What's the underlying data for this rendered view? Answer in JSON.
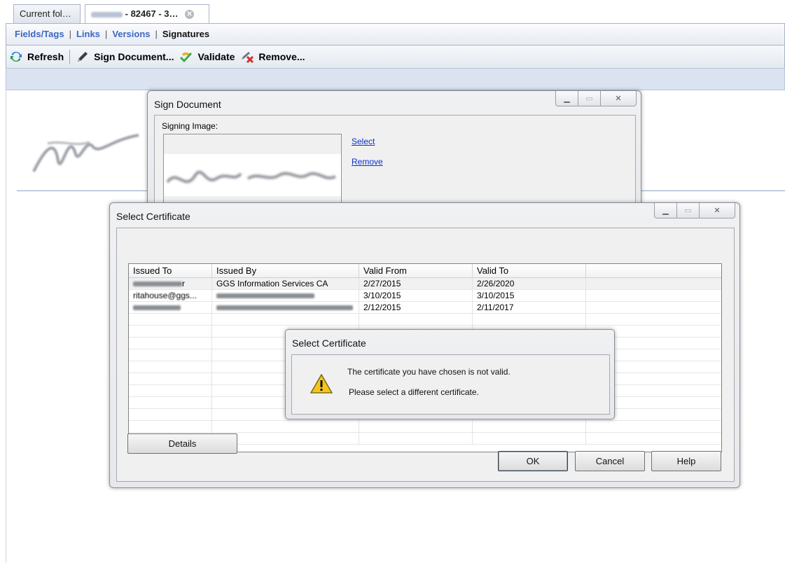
{
  "tabs": [
    {
      "label": "Current fol…"
    },
    {
      "label": "- 82467 - 3…"
    }
  ],
  "subnav": {
    "items": [
      "Fields/Tags",
      "Links",
      "Versions",
      "Signatures"
    ],
    "separator": "|"
  },
  "toolbar": {
    "refresh": "Refresh",
    "sign": "Sign Document...",
    "validate": "Validate",
    "remove": "Remove..."
  },
  "sign_document": {
    "title": "Sign Document",
    "signing_image_label": "Signing Image:",
    "select_link": "Select",
    "remove_link": "Remove"
  },
  "select_certificate": {
    "title": "Select Certificate",
    "columns": [
      "Issued To",
      "Issued By",
      "Valid From",
      "Valid To"
    ],
    "rows": [
      {
        "issued_to": "r",
        "issued_by": "GGS Information Services CA",
        "valid_from": "2/27/2015",
        "valid_to": "2/26/2020"
      },
      {
        "issued_to": "ritahouse@ggs...",
        "issued_by": "",
        "valid_from": "3/10/2015",
        "valid_to": "3/10/2015"
      },
      {
        "issued_to": "",
        "issued_by": "",
        "valid_from": "2/12/2015",
        "valid_to": "2/11/2017"
      }
    ],
    "details_button": "Details",
    "ok_button": "OK",
    "cancel_button": "Cancel",
    "help_button": "Help"
  },
  "alert": {
    "title": "Select Certificate",
    "line1": "The certificate you have chosen is not valid.",
    "line2": "Please select a different certificate."
  },
  "colors": {
    "link_blue": "#3b68c1",
    "dialog_link": "#0b2fc6",
    "warning_yellow": "#f5c518"
  }
}
